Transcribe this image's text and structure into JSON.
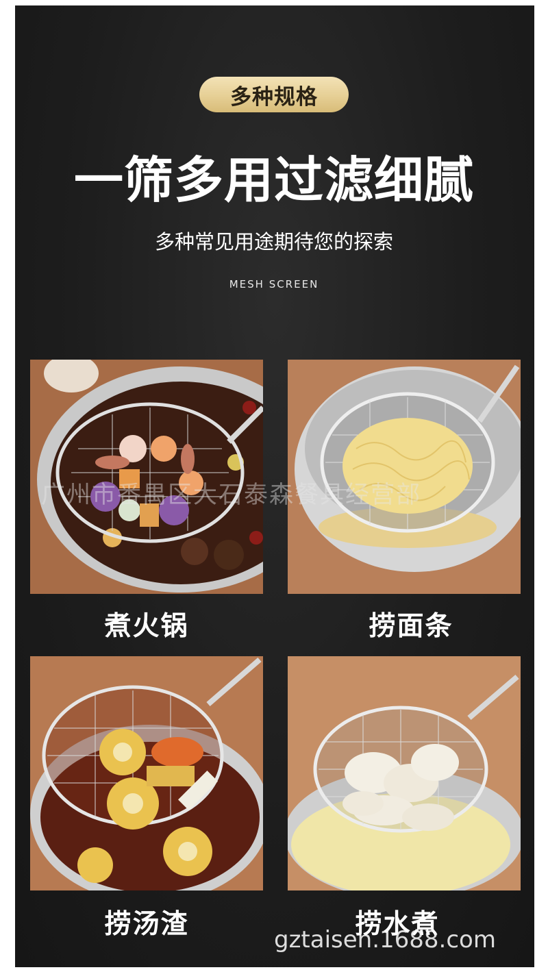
{
  "badge": "多种规格",
  "headline": "一筛多用过滤细腻",
  "subline": "多种常见用途期待您的探索",
  "english": "MESH SCREEN",
  "uses": [
    {
      "label": "煮火锅"
    },
    {
      "label": "捞面条"
    },
    {
      "label": "捞汤渣"
    },
    {
      "label": "捞水煮"
    }
  ],
  "watermark": "广州市番禺区大石泰森餐具经营部",
  "footer_url": "gztaisen.1688.com",
  "colors": {
    "badge_gold": "#e6cf95",
    "background": "#1d1d1d",
    "text": "#ffffff"
  }
}
